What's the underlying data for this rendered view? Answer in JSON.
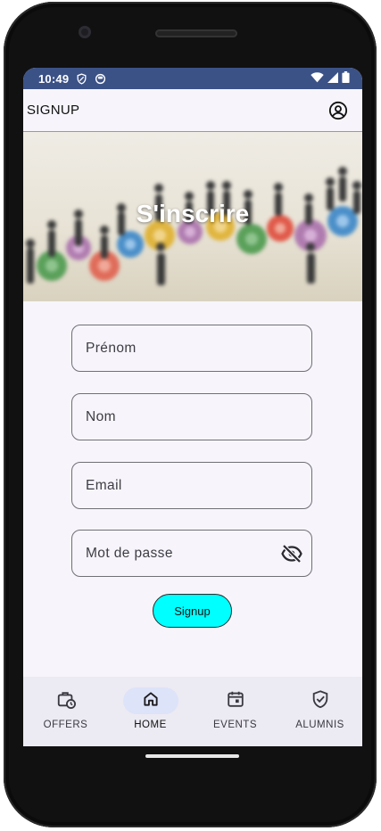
{
  "status_bar": {
    "time": "10:49"
  },
  "app_bar": {
    "title": "SIGNUP",
    "account_icon": "account-circle-icon"
  },
  "banner": {
    "heading": "S'inscrire",
    "image": "people-on-gears-illustration"
  },
  "form": {
    "first_name": {
      "placeholder": "Prénom",
      "value": ""
    },
    "last_name": {
      "placeholder": "Nom",
      "value": ""
    },
    "email": {
      "placeholder": "Email",
      "value": ""
    },
    "password": {
      "placeholder": "Mot de passe",
      "value": "",
      "toggle_icon": "visibility-off-icon"
    },
    "submit_label": "Signup"
  },
  "bottom_nav": {
    "items": [
      {
        "label": "OFFERS",
        "icon": "work-history-icon",
        "active": false
      },
      {
        "label": "HOME",
        "icon": "home-icon",
        "active": true
      },
      {
        "label": "EVENTS",
        "icon": "calendar-icon",
        "active": false
      },
      {
        "label": "ALUMNIS",
        "icon": "verified-shield-icon",
        "active": false
      }
    ]
  },
  "colors": {
    "status_bar": "#3b5287",
    "accent_button": "#00ffff",
    "nav_active_pill": "#dde3f8",
    "screen_background": "#f7f5fb",
    "nav_background": "#eceaf3"
  }
}
